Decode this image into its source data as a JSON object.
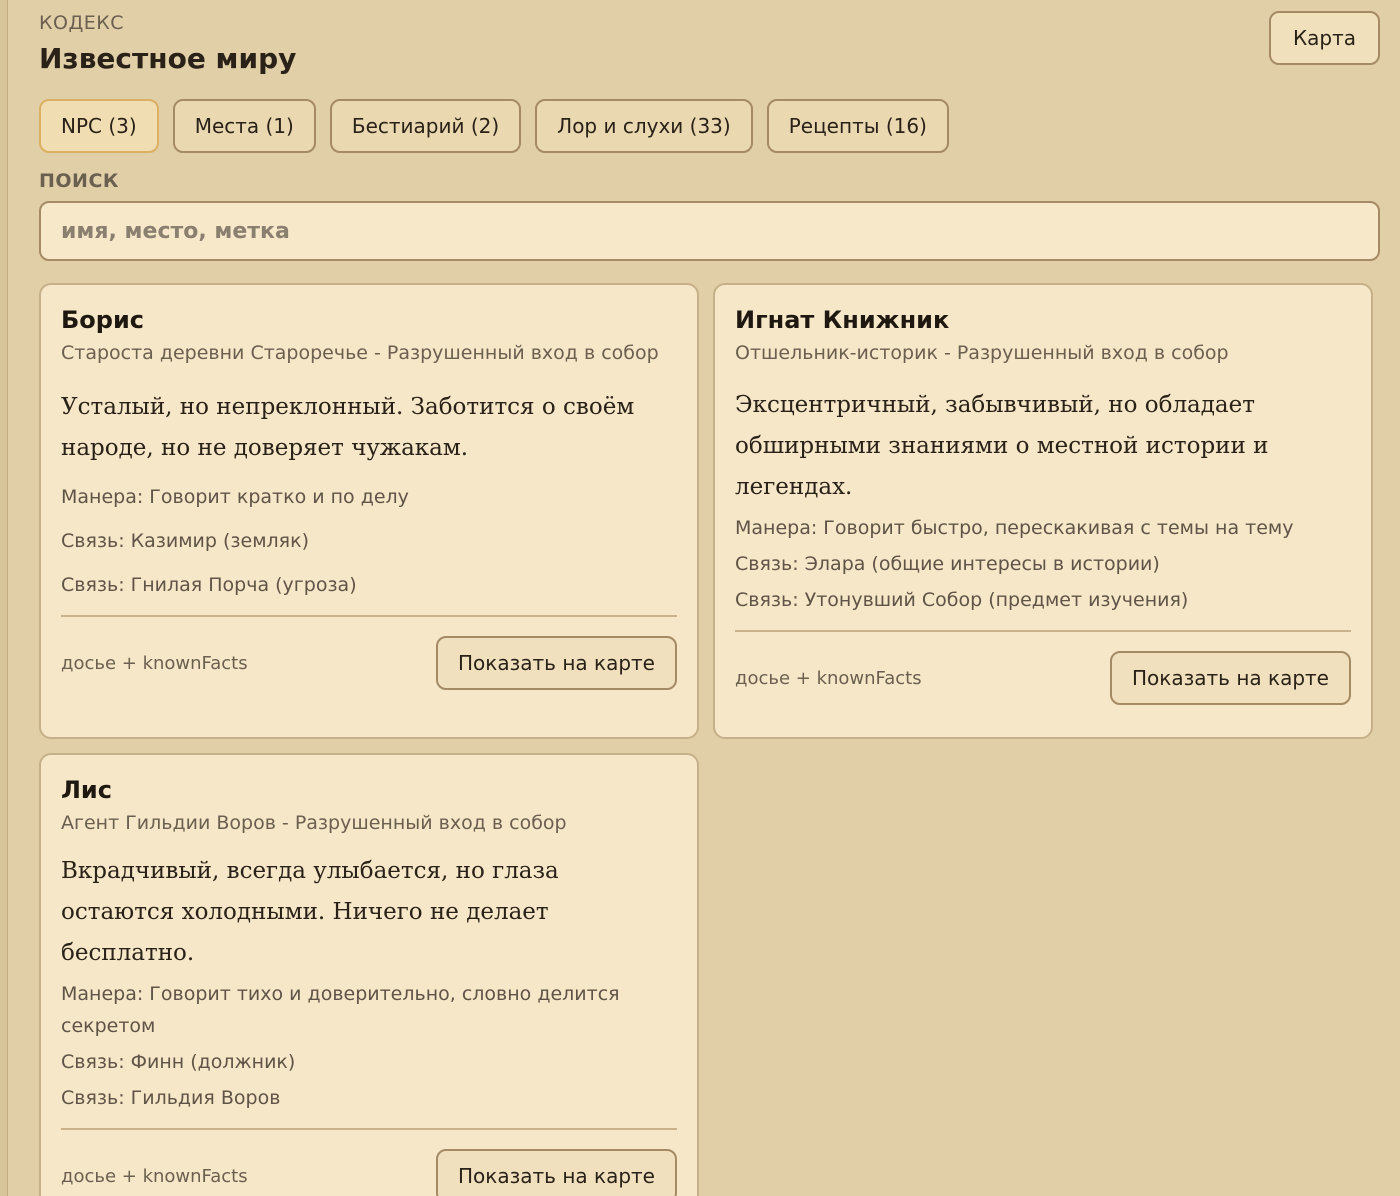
{
  "header": {
    "eyebrow": "КОДЕКС",
    "title": "Известное миру",
    "map_button": "Карта"
  },
  "tabs": [
    {
      "label": "NPC (3)",
      "active": true
    },
    {
      "label": "Места (1)",
      "active": false
    },
    {
      "label": "Бестиарий (2)",
      "active": false
    },
    {
      "label": "Лор и слухи (33)",
      "active": false
    },
    {
      "label": "Рецепты (16)",
      "active": false
    }
  ],
  "search": {
    "label": "ПОИСК",
    "value": "",
    "placeholder": "имя, место, метка"
  },
  "npcs": [
    {
      "name": "Борис",
      "subtitle": "Староста деревни Староречье - Разрушенный вход в собор",
      "description": "Усталый, но непреклонный. Заботится о своём народе, но не доверяет чужакам.",
      "traits": [
        "Манера: Говорит кратко и по делу",
        "Связь: Казимир (земляк)",
        "Связь: Гнилая Порча (угроза)"
      ],
      "meta": "досье + knownFacts",
      "button": "Показать на карте"
    },
    {
      "name": "Игнат Книжник",
      "subtitle": "Отшельник-историк - Разрушенный вход в собор",
      "description": "Эксцентричный, забывчивый, но обладает обширными знаниями о местной истории и легендах.",
      "traits": [
        "Манера: Говорит быстро, перескакивая с темы на тему",
        "Связь: Элара (общие интересы в истории)",
        "Связь: Утонувший Собор (предмет изучения)"
      ],
      "meta": "досье + knownFacts",
      "button": "Показать на карте"
    },
    {
      "name": "Лис",
      "subtitle": "Агент Гильдии Воров - Разрушенный вход в собор",
      "description": "Вкрадчивый, всегда улыбается, но глаза остаются холодными. Ничего не делает бесплатно.",
      "traits": [
        "Манера: Говорит тихо и доверительно, словно делится секретом",
        "Связь: Финн (должник)",
        "Связь: Гильдия Воров"
      ],
      "meta": "досье + knownFacts",
      "button": "Показать на карте"
    }
  ],
  "colors": {
    "background": "#e1cfa8",
    "card": "#f5e7c7",
    "active_tab_border": "#dcb062",
    "text": "#2a2118",
    "muted_text": "#6b5f50"
  }
}
